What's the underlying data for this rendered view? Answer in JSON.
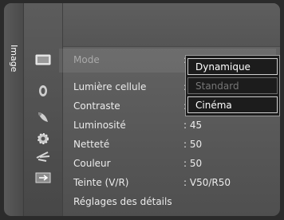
{
  "side_tab": {
    "label": "Image"
  },
  "menu": {
    "rows": [
      {
        "label": "Mode",
        "value": ":",
        "icon": "tv-screen-icon"
      },
      {
        "label": "Lumière cellule",
        "value": ":",
        "icon": "bulb-icon"
      },
      {
        "label": "Contraste",
        "value": ":",
        "icon": "satellite-dish-icon"
      },
      {
        "label": "Luminosité",
        "value": ": 45",
        "icon": "gear-icon"
      },
      {
        "label": "Netteté",
        "value": ": 50",
        "icon": "antenna-icon"
      },
      {
        "label": "Couleur",
        "value": ": 50",
        "icon": "input-icon"
      },
      {
        "label": "Teinte (V/R)",
        "value": ": V50/R50"
      },
      {
        "label": "Réglages des détails"
      }
    ]
  },
  "dropdown": {
    "options": [
      {
        "label": "Dynamique",
        "enabled": true
      },
      {
        "label": "Standard",
        "enabled": false
      },
      {
        "label": "Cinéma",
        "enabled": true
      }
    ]
  },
  "colors": {
    "text": "#ececec",
    "text_dim": "#a9a9a9",
    "dropdown_bg": "#1c1c1c"
  }
}
